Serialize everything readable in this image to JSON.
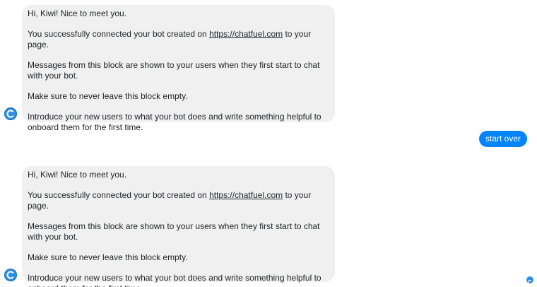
{
  "colors": {
    "bot_bubble": "#f1f0f0",
    "user_bubble": "#0084ff",
    "avatar": "#2d8ee5",
    "text": "#1d2129"
  },
  "messages": [
    {
      "sender": "bot",
      "avatar_icon": "chatfuel-logo-icon",
      "greeting": "Hi, Kiwi! Nice to meet you.",
      "connected_prefix": "You successfully connected your bot created on ",
      "connected_link": "https://chatfuel.com",
      "connected_suffix": " to your page.",
      "shown_text": "Messages from this block are shown to your users when they first start to chat with your bot.",
      "empty_warning": "Make sure to never leave this block empty.",
      "introduce_text": "Introduce your new users to what your bot does and write something helpful to onboard them for the first time."
    },
    {
      "sender": "user",
      "text": "start over"
    },
    {
      "sender": "bot",
      "avatar_icon": "chatfuel-logo-icon",
      "greeting": "Hi, Kiwi! Nice to meet you.",
      "connected_prefix": "You successfully connected your bot created on ",
      "connected_link": "https://chatfuel.com",
      "connected_suffix": " to your page.",
      "shown_text": "Messages from this block are shown to your users when they first start to chat with your bot.",
      "empty_warning": "Make sure to never leave this block empty.",
      "introduce_text": "Introduce your new users to what your bot does and write something helpful to onboard them for the first time."
    }
  ],
  "seen_indicator_icon": "seen-avatar-icon"
}
